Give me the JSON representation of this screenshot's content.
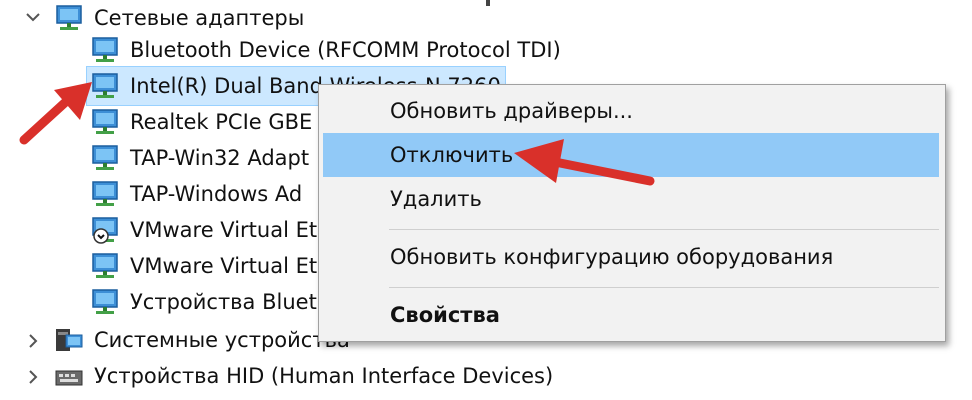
{
  "tree": {
    "network_adapters": {
      "label": "Сетевые адаптеры",
      "children": [
        {
          "label": "Bluetooth Device (RFCOMM Protocol TDI)",
          "icon": "network-adapter-icon"
        },
        {
          "label": "Intel(R) Dual Band Wireless-N 7260",
          "icon": "network-adapter-icon",
          "selected": true
        },
        {
          "label": "Realtek PCIe GBE",
          "icon": "network-adapter-icon"
        },
        {
          "label": "TAP-Win32 Adapt",
          "icon": "network-adapter-icon"
        },
        {
          "label": "TAP-Windows Ad",
          "icon": "network-adapter-icon"
        },
        {
          "label": "VMware Virtual Et",
          "icon": "network-adapter-disabled-icon"
        },
        {
          "label": "VMware Virtual Et",
          "icon": "network-adapter-icon"
        },
        {
          "label": "Устройства Bluet",
          "icon": "network-adapter-icon"
        }
      ]
    },
    "system_devices": {
      "label": "Системные устройства",
      "icon": "system-devices-icon"
    },
    "hid_devices": {
      "label": "Устройства HID (Human Interface Devices)",
      "icon": "hid-devices-icon"
    }
  },
  "context_menu": {
    "update_drivers": "Обновить драйверы...",
    "disable": "Отключить",
    "uninstall": "Удалить",
    "scan_hardware": "Обновить конфигурацию оборудования",
    "properties": "Свойства"
  },
  "colors": {
    "selection_bg": "#cce8ff",
    "menu_highlight": "#91c9f7",
    "menu_bg": "#f2f2f2",
    "arrow_red": "#d9302a"
  }
}
